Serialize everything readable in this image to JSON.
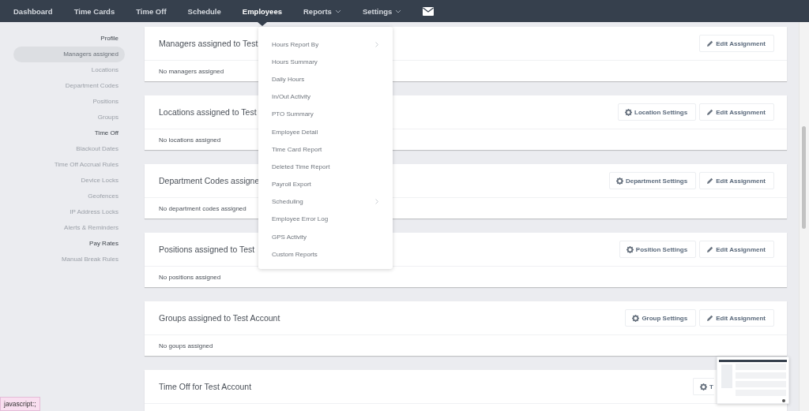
{
  "nav": {
    "items": [
      {
        "label": "Dashboard",
        "selected": false,
        "dropdown": false
      },
      {
        "label": "Time Cards",
        "selected": false,
        "dropdown": false
      },
      {
        "label": "Time Off",
        "selected": false,
        "dropdown": false
      },
      {
        "label": "Schedule",
        "selected": false,
        "dropdown": false
      },
      {
        "label": "Employees",
        "selected": true,
        "dropdown": false
      },
      {
        "label": "Reports",
        "selected": false,
        "dropdown": true
      },
      {
        "label": "Settings",
        "selected": false,
        "dropdown": true
      }
    ]
  },
  "sidebar": {
    "items": [
      {
        "label": "Profile",
        "kind": "section",
        "selected": false
      },
      {
        "label": "Managers assigned",
        "kind": "link",
        "selected": true
      },
      {
        "label": "Locations",
        "kind": "link",
        "selected": false
      },
      {
        "label": "Department Codes",
        "kind": "link",
        "selected": false
      },
      {
        "label": "Positions",
        "kind": "link",
        "selected": false
      },
      {
        "label": "Groups",
        "kind": "link",
        "selected": false
      },
      {
        "label": "Time Off",
        "kind": "section",
        "selected": false
      },
      {
        "label": "Blackout Dates",
        "kind": "link",
        "selected": false
      },
      {
        "label": "Time Off Accrual Rules",
        "kind": "link",
        "selected": false
      },
      {
        "label": "Device Locks",
        "kind": "link",
        "selected": false
      },
      {
        "label": "Geofences",
        "kind": "link",
        "selected": false
      },
      {
        "label": "IP Address Locks",
        "kind": "link",
        "selected": false
      },
      {
        "label": "Alerts & Reminders",
        "kind": "link",
        "selected": false
      },
      {
        "label": "Pay Rates",
        "kind": "section",
        "selected": false
      },
      {
        "label": "Manual Break Rules",
        "kind": "link",
        "selected": false
      }
    ]
  },
  "cards": [
    {
      "title": "Managers assigned to Test",
      "body": "No managers assigned",
      "buttons": [
        {
          "kind": "edit",
          "label": "Edit Assignment"
        }
      ]
    },
    {
      "title": "Locations assigned to Test",
      "body": "No locations assigned",
      "buttons": [
        {
          "kind": "settings",
          "label": "Location Settings"
        },
        {
          "kind": "edit",
          "label": "Edit Assignment"
        }
      ]
    },
    {
      "title": "Department Codes assigne",
      "body": "No department codes assigned",
      "buttons": [
        {
          "kind": "settings",
          "label": "Department Settings"
        },
        {
          "kind": "edit",
          "label": "Edit Assignment"
        }
      ]
    },
    {
      "title": "Positions assigned to Test",
      "body": "No positions assigned",
      "buttons": [
        {
          "kind": "settings",
          "label": "Position Settings"
        },
        {
          "kind": "edit",
          "label": "Edit Assignment"
        }
      ]
    },
    {
      "title": "Groups assigned to Test Account",
      "body": "No goups assigned",
      "buttons": [
        {
          "kind": "settings",
          "label": "Group Settings"
        },
        {
          "kind": "edit",
          "label": "Edit Assignment"
        }
      ]
    },
    {
      "title": "Time Off for Test Account",
      "buttons": [
        {
          "kind": "settings",
          "label": "T"
        }
      ]
    }
  ],
  "reports_menu": {
    "items": [
      {
        "label": "Hours Report By",
        "submenu": true
      },
      {
        "label": "Hours Summary",
        "submenu": false
      },
      {
        "label": "Daily Hours",
        "submenu": false
      },
      {
        "label": "In/Out Activity",
        "submenu": false
      },
      {
        "label": "PTO Summary",
        "submenu": false
      },
      {
        "label": "Employee Detail",
        "submenu": false
      },
      {
        "label": "Time Card Report",
        "submenu": false
      },
      {
        "label": "Deleted Time Report",
        "submenu": false
      },
      {
        "label": "Payroll Export",
        "submenu": false
      },
      {
        "label": "Scheduling",
        "submenu": true
      },
      {
        "label": "Employee Error Log",
        "submenu": false
      },
      {
        "label": "GPS Activity",
        "submenu": false
      },
      {
        "label": "Custom Reports",
        "submenu": false
      }
    ]
  },
  "status_bar": {
    "url": "javascript:;"
  }
}
